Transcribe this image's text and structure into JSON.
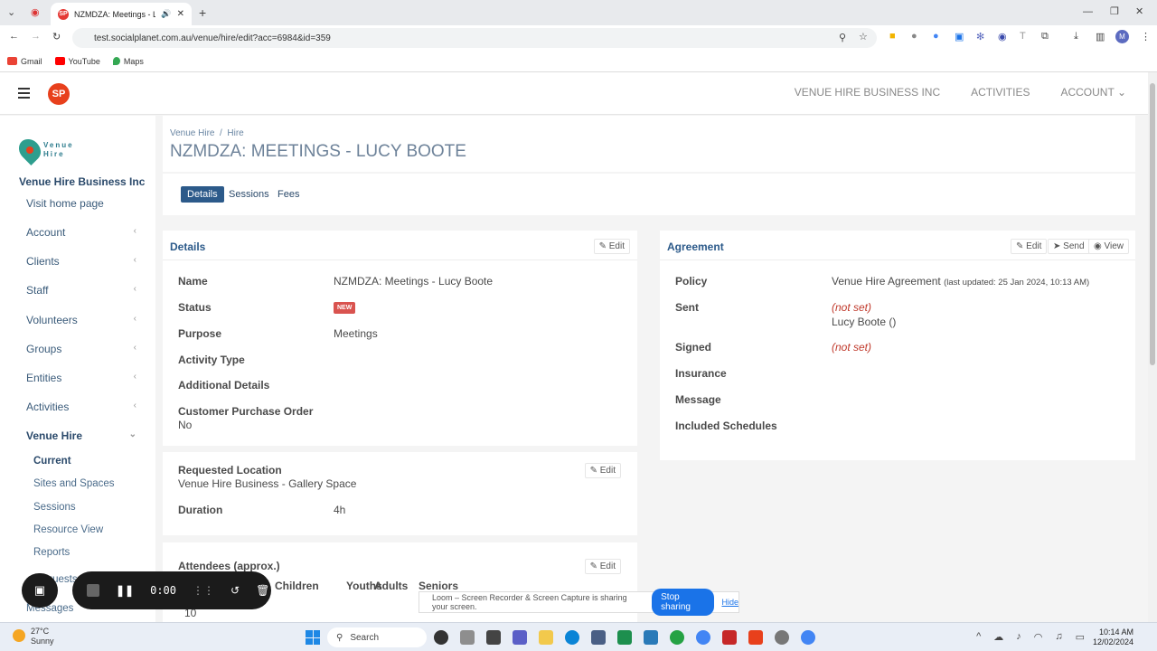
{
  "browser": {
    "tab_title": "NZMDZA: Meetings - Lucy",
    "url": "test.socialplanet.com.au/venue/hire/edit?acc=6984&id=359",
    "bookmarks": [
      "Gmail",
      "YouTube",
      "Maps"
    ]
  },
  "header": {
    "logo_text": "SP",
    "nav": [
      "VENUE HIRE BUSINESS INC",
      "ACTIVITIES",
      "ACCOUNT"
    ]
  },
  "sidebar": {
    "org_logo_lines": [
      "Venue",
      "Hire"
    ],
    "org_name": "Venue Hire Business Inc",
    "items": [
      {
        "label": "Visit home page"
      },
      {
        "label": "Account"
      },
      {
        "label": "Clients"
      },
      {
        "label": "Staff"
      },
      {
        "label": "Volunteers"
      },
      {
        "label": "Groups"
      },
      {
        "label": "Entities"
      },
      {
        "label": "Activities"
      },
      {
        "label": "Venue Hire"
      }
    ],
    "sub_items": [
      "Current",
      "Sites and Spaces",
      "Sessions",
      "Resource View",
      "Reports",
      "Requests",
      "Messages"
    ]
  },
  "page": {
    "breadcrumb": [
      "Venue Hire",
      "/",
      "Hire"
    ],
    "title": "NZMDZA: MEETINGS - LUCY BOOTE",
    "tabs": [
      "Details",
      "Sessions",
      "Fees"
    ]
  },
  "details": {
    "title": "Details",
    "edit": "Edit",
    "rows": [
      {
        "label": "Name",
        "value": "NZMDZA: Meetings - Lucy Boote"
      },
      {
        "label": "Status",
        "value": "NEW"
      },
      {
        "label": "Purpose",
        "value": "Meetings"
      },
      {
        "label": "Activity Type",
        "value": ""
      },
      {
        "label": "Additional Details",
        "value": ""
      },
      {
        "label": "Customer Purchase Order",
        "value": "No"
      }
    ]
  },
  "location": {
    "label": "Requested Location",
    "value": "Venue Hire Business - Gallery Space",
    "edit": "Edit",
    "duration_label": "Duration",
    "duration_value": "4h"
  },
  "attendees": {
    "label": "Attendees (approx.)",
    "edit": "Edit",
    "columns": [
      "Children",
      "Youths",
      "Adults",
      "Seniors"
    ],
    "total": "10"
  },
  "agreement": {
    "title": "Agreement",
    "actions": [
      "Edit",
      "Send",
      "View"
    ],
    "policy_label": "Policy",
    "policy_value": "Venue Hire Agreement",
    "policy_note": "(last updated: 25 Jan 2024, 10:13 AM)",
    "sent_label": "Sent",
    "sent_value": "(not set)",
    "sent_to": "Lucy Boote ()",
    "signed_label": "Signed",
    "signed_value": "(not set)",
    "insurance_label": "Insurance",
    "message_label": "Message",
    "schedules_label": "Included Schedules"
  },
  "loom": {
    "timer": "0:00",
    "sharing_text": "Loom – Screen Recorder & Screen Capture is sharing your screen.",
    "stop": "Stop sharing",
    "hide": "Hide"
  },
  "taskbar": {
    "temp": "27°C",
    "weather": "Sunny",
    "search": "Search",
    "time": "10:14 AM",
    "date": "12/02/2024"
  }
}
